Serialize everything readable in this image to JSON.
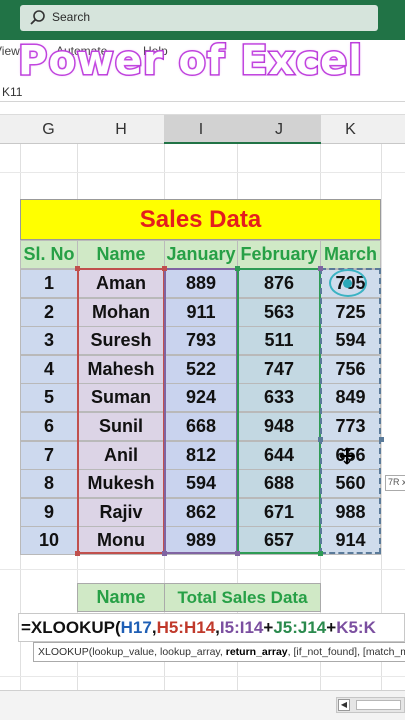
{
  "search": {
    "placeholder": "Search"
  },
  "ribbon": {
    "tabs": [
      "View",
      "Automate",
      "Help"
    ]
  },
  "overlay": {
    "title": "Power of Excel"
  },
  "namebox": {
    "value": "K11"
  },
  "columns": [
    "G",
    "H",
    "I",
    "J",
    "K"
  ],
  "sheet": {
    "title": "Sales Data",
    "headers": [
      "Sl. No",
      "Name",
      "January",
      "February",
      "March"
    ],
    "rows": [
      [
        "1",
        "Aman",
        "889",
        "876",
        "705"
      ],
      [
        "2",
        "Mohan",
        "911",
        "563",
        "725"
      ],
      [
        "3",
        "Suresh",
        "793",
        "511",
        "594"
      ],
      [
        "4",
        "Mahesh",
        "522",
        "747",
        "756"
      ],
      [
        "5",
        "Suman",
        "924",
        "633",
        "849"
      ],
      [
        "6",
        "Sunil",
        "668",
        "948",
        "773"
      ],
      [
        "7",
        "Anil",
        "812",
        "644",
        "656"
      ],
      [
        "8",
        "Mukesh",
        "594",
        "688",
        "560"
      ],
      [
        "9",
        "Rajiv",
        "862",
        "671",
        "988"
      ],
      [
        "10",
        "Monu",
        "989",
        "657",
        "914"
      ]
    ]
  },
  "lookup": {
    "name_header": "Name",
    "total_header": "Total Sales Data"
  },
  "formula": {
    "prefix": "=XLOOKUP(",
    "arg1": "H17",
    "sep1": ",",
    "arg2": "H5:H14",
    "sep2": ",",
    "arg3": "I5:I14",
    "plus1": "+",
    "arg4": "J5:J14",
    "plus2": "+",
    "arg5": "K5:K"
  },
  "hint": {
    "pre": "XLOOKUP(lookup_value, lookup_array, ",
    "bold": "return_array",
    "post": ", [if_not_found], [match_mode], [search_mode])"
  },
  "tooltip": {
    "text": "7R x"
  },
  "colors": {
    "excel_green": "#217346",
    "title_red": "#e41e1e",
    "header_green": "#27a046",
    "title_yellow": "#ffff00"
  }
}
